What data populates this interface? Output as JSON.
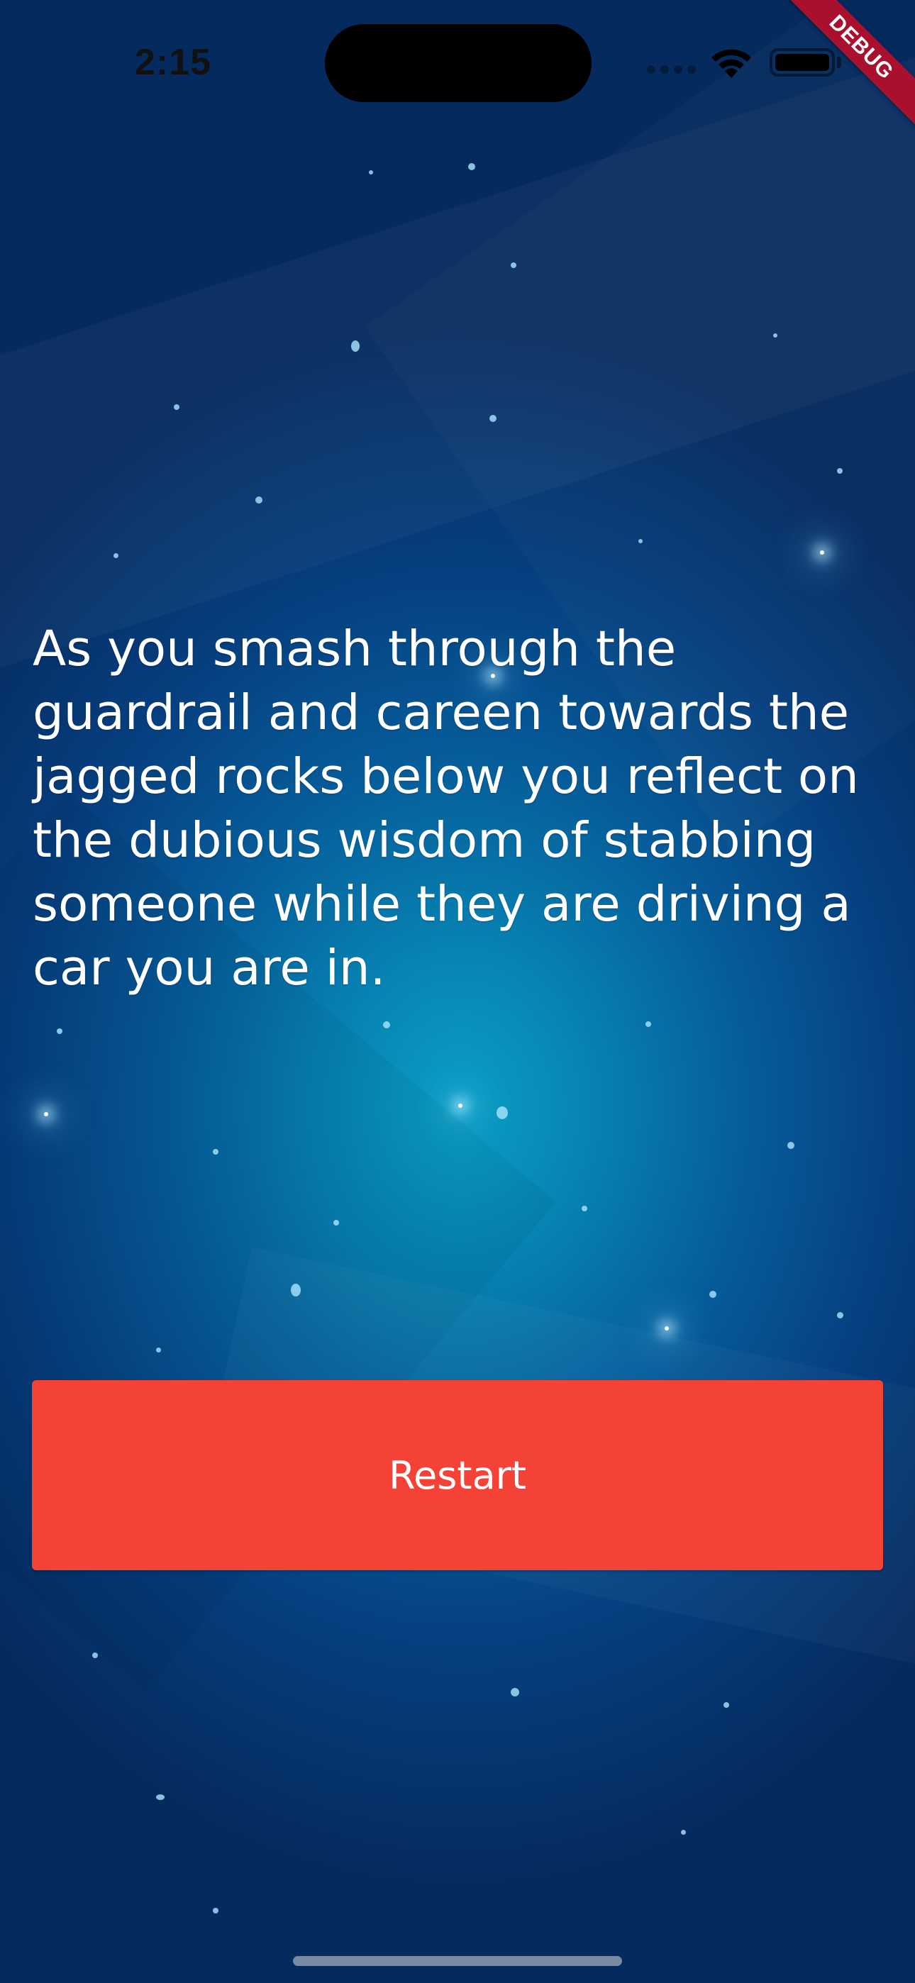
{
  "status_bar": {
    "time": "2:15",
    "wifi_icon": "wifi-icon",
    "battery_icon": "battery-icon"
  },
  "debug_banner": {
    "label": "DEBUG",
    "color": "#a8102e"
  },
  "story": {
    "text": "As you smash through the guardrail and careen towards the jagged rocks below you reflect on the dubious wisdom of stabbing someone while they are driving a car you are in."
  },
  "actions": {
    "restart_label": "Restart",
    "restart_color": "#f44336"
  }
}
